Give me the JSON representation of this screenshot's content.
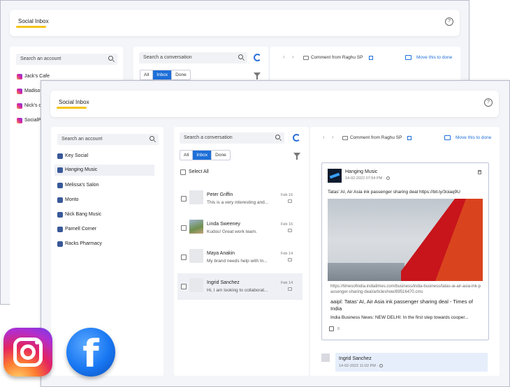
{
  "app": {
    "title": "Social Inbox",
    "help": "?"
  },
  "back_window": {
    "account_search_placeholder": "Search an account",
    "accounts": [
      "Jack's Cafe",
      "Madiso",
      "Nick's c",
      "SocialPi"
    ],
    "conversation_search_placeholder": "Search a conversation",
    "filters": [
      "All",
      "Inbox",
      "Done"
    ],
    "header_title": "Comment from Raghu SP",
    "move_done": "Move this to done"
  },
  "front_window": {
    "account_search_placeholder": "Search an account",
    "accounts": [
      "Key Social",
      "Hanging Music",
      "Melissa's Salon",
      "Monto",
      "Nick Bang Music",
      "Parnell Corner",
      "Racks Pharmacy"
    ],
    "conversation_search_placeholder": "Search a conversation",
    "filters": [
      "All",
      "Inbox",
      "Done"
    ],
    "select_all": "Select All",
    "conversations": [
      {
        "name": "Peter Griffin",
        "message": "This is a very interesting and...",
        "date": "Feb 16"
      },
      {
        "name": "Linda Sweeney",
        "message": "Kudos! Great work team.",
        "date": "Feb 16"
      },
      {
        "name": "Maya Anakin",
        "message": "My brand needs help with In...",
        "date": "Feb 14"
      },
      {
        "name": "Ingrid Sanchez",
        "message": "Hi, I am looking to collaborat...",
        "date": "Feb 14"
      }
    ],
    "header_title": "Comment from Raghu SP",
    "move_done": "Move this to done",
    "post": {
      "author": "Hanging Music",
      "time": "14-02-2022 07:54 PM ·",
      "text": "Tatas' AI, Air Asia ink passenger sharing deal https://bit.ly/3oiaq9U",
      "link_url": "https://timesofindia.indiatimes.com/business/india-business/tatas-ai-air-asia-ink-passenger-sharing-deal/articleshow/89516470.cms",
      "link_title": "aaipl: Tatas' AI, Air Asia ink passenger sharing deal - Times of India",
      "link_desc": "India Business News: NEW DELHI: In the first step towards cooper...",
      "likes": "0"
    },
    "reply": {
      "name": "Ingrid Sanchez",
      "time": "14-02-2022 11:02 PM ·"
    }
  },
  "icons": {
    "instagram": "instagram-icon",
    "facebook": "facebook-icon",
    "facebook_glyph": "f"
  },
  "colors": {
    "accent": "#1e6fd9",
    "tab_underline": "#f5c518",
    "background": "#f4f5f9"
  }
}
